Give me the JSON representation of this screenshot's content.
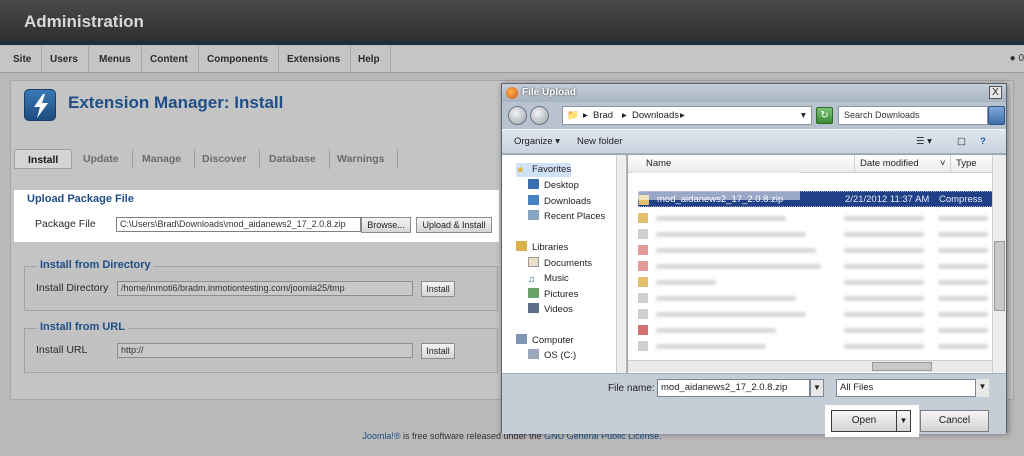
{
  "admin": {
    "title": "Administration",
    "menu": [
      "Site",
      "Users",
      "Menus",
      "Content",
      "Components",
      "Extensions",
      "Help"
    ],
    "user_count": "0",
    "page_title": "Extension Manager: Install",
    "tabs": [
      "Install",
      "Update",
      "Manage",
      "Discover",
      "Database",
      "Warnings"
    ],
    "upload": {
      "legend": "Upload Package File",
      "label": "Package File",
      "value": "C:\\Users\\Brad\\Downloads\\mod_aidanews2_17_2.0.8.zip",
      "browse": "Browse...",
      "submit": "Upload & Install"
    },
    "directory": {
      "legend": "Install from Directory",
      "label": "Install Directory",
      "value": "/home/inmoti6/bradm.inmotiontesting.com/joomla25/tmp",
      "submit": "Install"
    },
    "url": {
      "legend": "Install from URL",
      "label": "Install URL",
      "value": "http://",
      "submit": "Install"
    },
    "footer": {
      "link1": "Joomla!®",
      "text": " is free software released under the ",
      "link2": "GNU General Public License",
      "end": "."
    }
  },
  "dialog": {
    "title": "File Upload",
    "close": "X",
    "path": [
      "Brad",
      "Downloads"
    ],
    "search_placeholder": "Search Downloads",
    "toolbar": {
      "organize": "Organize",
      "new_folder": "New folder"
    },
    "nav": {
      "favorites": "Favorites",
      "items_fav": [
        "Desktop",
        "Downloads",
        "Recent Places"
      ],
      "libraries": "Libraries",
      "items_lib": [
        "Documents",
        "Music",
        "Pictures",
        "Videos"
      ],
      "computer": "Computer",
      "items_comp": [
        "OS (C:)"
      ]
    },
    "columns": {
      "name": "Name",
      "date": "Date modified",
      "type": "Type"
    },
    "selected_file": {
      "name": "mod_aidanews2_17_2.0.8.zip",
      "date": "2/21/2012 11:37 AM",
      "type": "Compress"
    },
    "file_name_label": "File name:",
    "file_name_value": "mod_aidanews2_17_2.0.8.zip",
    "filter": "All Files",
    "open": "Open",
    "cancel": "Cancel"
  },
  "colors": {
    "brand_blue": "#1f4f87",
    "selection": "#1f3f86"
  }
}
